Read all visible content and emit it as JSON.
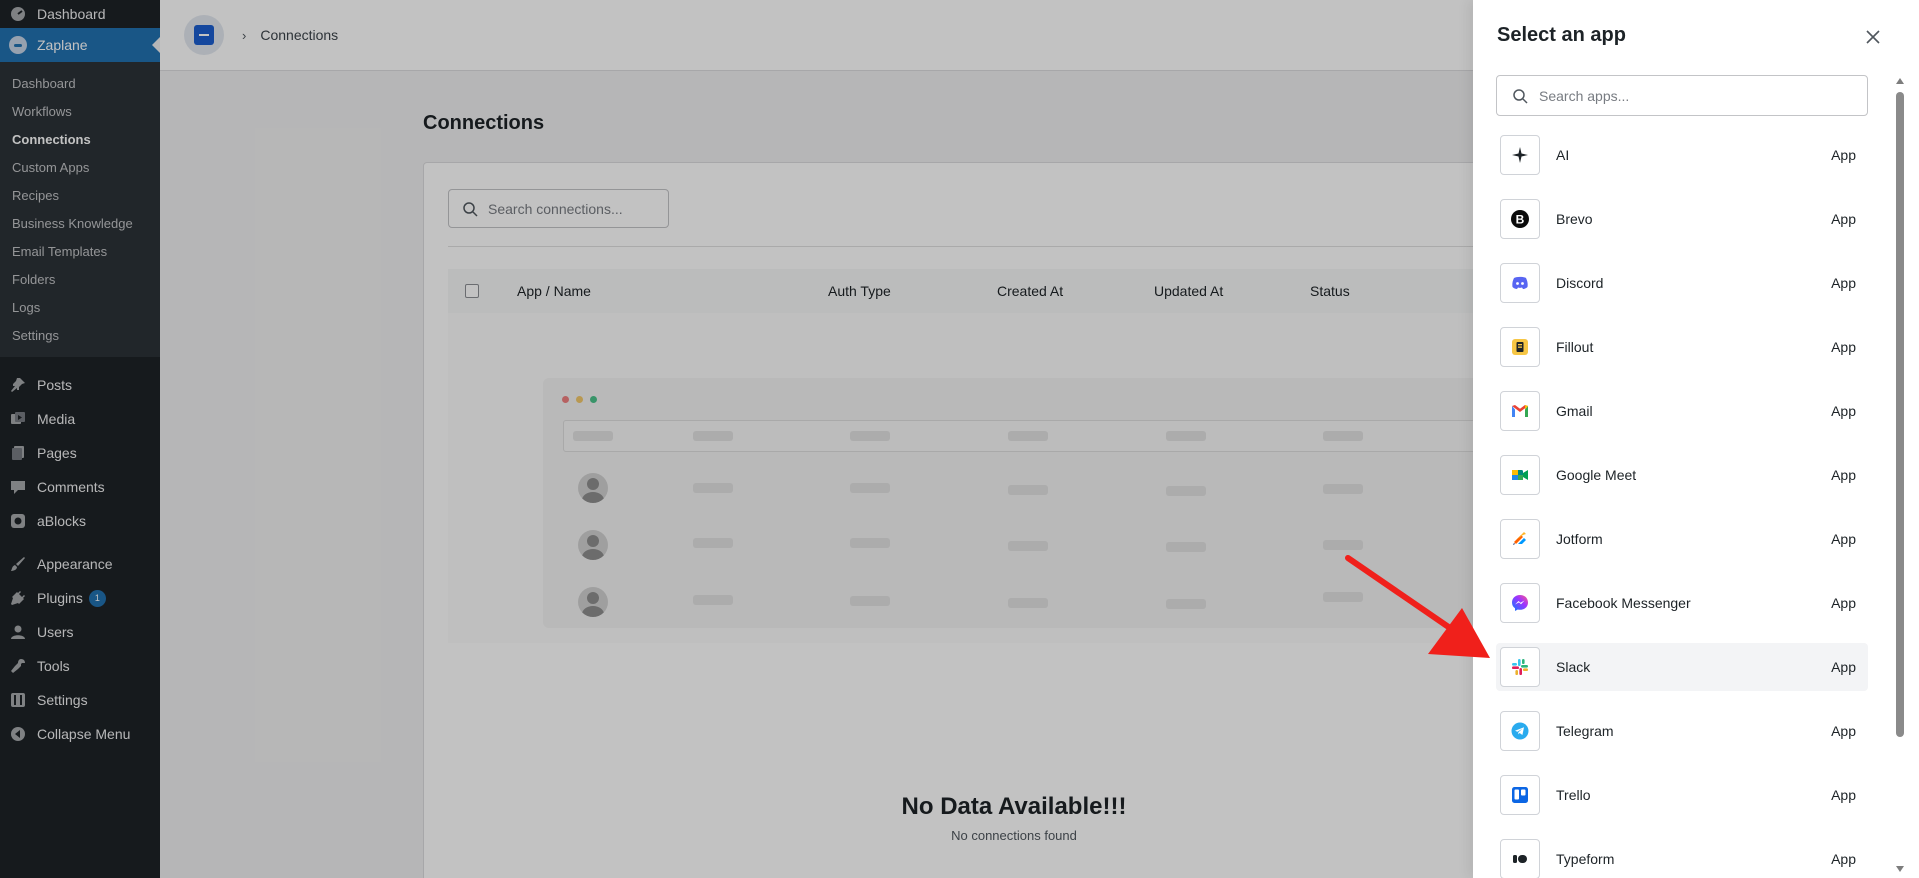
{
  "wp_sidebar": {
    "dashboard_label": "Dashboard",
    "active_plugin_label": "Zaplane",
    "submenu": [
      "Dashboard",
      "Workflows",
      "Connections",
      "Custom Apps",
      "Recipes",
      "Business Knowledge",
      "Email Templates",
      "Folders",
      "Logs",
      "Settings"
    ],
    "current_submenu": "Connections",
    "menu": {
      "posts": "Posts",
      "media": "Media",
      "pages": "Pages",
      "comments": "Comments",
      "ablocks": "aBlocks",
      "appearance": "Appearance",
      "plugins": "Plugins",
      "plugins_badge": "1",
      "users": "Users",
      "tools": "Tools",
      "settings": "Settings",
      "collapse": "Collapse Menu"
    }
  },
  "header": {
    "breadcrumb": "Connections"
  },
  "main": {
    "page_title": "Connections",
    "search_placeholder": "Search connections...",
    "columns": [
      "App / Name",
      "Auth Type",
      "Created At",
      "Updated At",
      "Status"
    ],
    "empty_title": "No Data Available!!!",
    "empty_subtitle": "No connections found"
  },
  "drawer": {
    "title": "Select an app",
    "search_placeholder": "Search apps...",
    "apps": [
      {
        "name": "AI",
        "type": "App",
        "icon": "sparkle-icon"
      },
      {
        "name": "Brevo",
        "type": "App",
        "icon": "brevo-icon"
      },
      {
        "name": "Discord",
        "type": "App",
        "icon": "discord-icon"
      },
      {
        "name": "Fillout",
        "type": "App",
        "icon": "fillout-icon"
      },
      {
        "name": "Gmail",
        "type": "App",
        "icon": "gmail-icon"
      },
      {
        "name": "Google Meet",
        "type": "App",
        "icon": "google-meet-icon"
      },
      {
        "name": "Jotform",
        "type": "App",
        "icon": "jotform-icon"
      },
      {
        "name": "Facebook Messenger",
        "type": "App",
        "icon": "messenger-icon"
      },
      {
        "name": "Slack",
        "type": "App",
        "icon": "slack-icon"
      },
      {
        "name": "Telegram",
        "type": "App",
        "icon": "telegram-icon"
      },
      {
        "name": "Trello",
        "type": "App",
        "icon": "trello-icon"
      },
      {
        "name": "Typeform",
        "type": "App",
        "icon": "typeform-icon"
      }
    ],
    "highlighted_app": "Slack"
  },
  "colors": {
    "wp_sidebar_bg": "#1d2327",
    "wp_accent": "#2271b1",
    "annotation_arrow": "#f0201b"
  }
}
